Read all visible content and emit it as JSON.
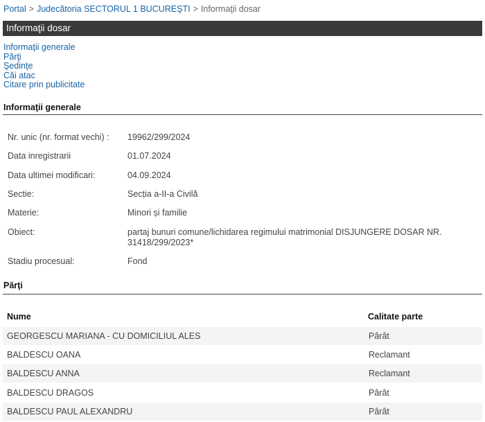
{
  "breadcrumb": {
    "portal": "Portal",
    "court": "Judecătoria SECTORUL 1 BUCUREŞTI",
    "current": "Informaţii dosar",
    "separator": ">"
  },
  "header": {
    "title": "Informaţii dosar",
    "background": "#3a3a3a"
  },
  "section_links": [
    "Informaţii generale",
    "Părţi",
    "Şedinţe",
    "Căi atac",
    "Citare prin publicitate"
  ],
  "general_info": {
    "title": "Informaţii generale",
    "rows": [
      {
        "label": "Nr. unic (nr. format vechi) :",
        "value": "19962/299/2024"
      },
      {
        "label": "Data inregistrarii",
        "value": "01.07.2024"
      },
      {
        "label": "Data ultimei modificari:",
        "value": "04.09.2024"
      },
      {
        "label": "Sectie:",
        "value": "Secția a-II-a Civilă"
      },
      {
        "label": "Materie:",
        "value": "Minori și familie"
      },
      {
        "label": "Obiect:",
        "value": "partaj bunuri comune/lichidarea regimului matrimonial DISJUNGERE DOSAR NR. 31418/299/2023*"
      },
      {
        "label": "Stadiu procesual:",
        "value": "Fond"
      }
    ]
  },
  "parti": {
    "title": "Părţi",
    "columns": {
      "name": "Nume",
      "role": "Calitate parte"
    },
    "rows": [
      {
        "name": "GEORGESCU MARIANA - CU DOMICILIUL ALES",
        "role": "Pârât"
      },
      {
        "name": "BALDESCU OANA",
        "role": "Reclamant"
      },
      {
        "name": "BALDESCU ANNA",
        "role": "Reclamant"
      },
      {
        "name": "BALDESCU DRAGOS",
        "role": "Pârât"
      },
      {
        "name": "BALDESCU PAUL ALEXANDRU",
        "role": "Pârât"
      }
    ]
  },
  "colors": {
    "link": "#1a63a6",
    "alt_row": "#f4f4f4"
  }
}
